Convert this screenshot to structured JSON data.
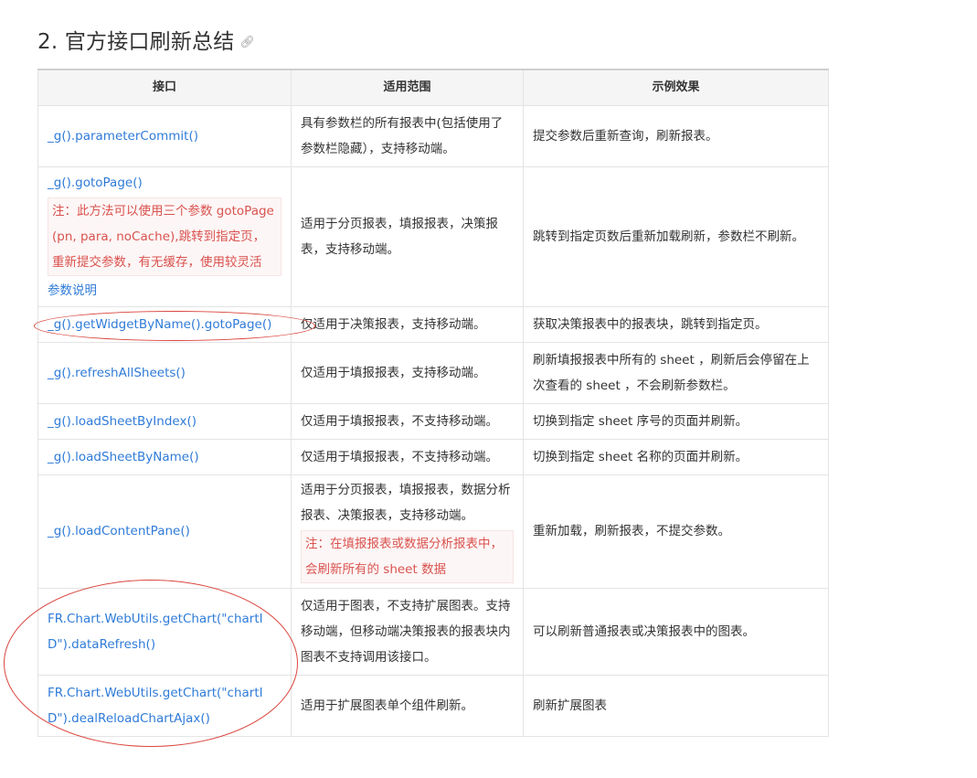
{
  "heading": {
    "title": "2. 官方接口刷新总结"
  },
  "table": {
    "headers": [
      "接口",
      "适用范围",
      "示例效果"
    ],
    "rows": [
      {
        "api": "_g().parameterCommit()",
        "scope": "具有参数栏的所有报表中(包括使用了参数栏隐藏），支持移动端。",
        "effect": "提交参数后重新查询，刷新报表。"
      },
      {
        "api": "_g().gotoPage()",
        "api_note": "注：此方法可以使用三个参数 gotoPage(pn, para, noCache),跳转到指定页，重新提交参数，有无缓存，使用较灵活",
        "api_link": "参数说明",
        "scope": "适用于分页报表，填报报表，决策报表，支持移动端。",
        "effect": "跳转到指定页数后重新加载刷新，参数栏不刷新。"
      },
      {
        "api": "_g().getWidgetByName().gotoPage()",
        "scope": "仅适用于决策报表，支持移动端。",
        "effect": "获取决策报表中的报表块，跳转到指定页。"
      },
      {
        "api": "_g().refreshAllSheets()",
        "scope": "仅适用于填报报表，支持移动端。",
        "effect": "刷新填报报表中所有的 sheet ，刷新后会停留在上次查看的 sheet ，不会刷新参数栏。"
      },
      {
        "api": "_g().loadSheetByIndex()",
        "scope": "仅适用于填报报表，不支持移动端。",
        "effect": "切换到指定 sheet 序号的页面并刷新。"
      },
      {
        "api": "_g().loadSheetByName()",
        "scope": "仅适用于填报报表，不支持移动端。",
        "effect": "切换到指定 sheet 名称的页面并刷新。"
      },
      {
        "api": "_g().loadContentPane()",
        "scope": "适用于分页报表，填报报表，数据分析报表、决策报表，支持移动端。",
        "scope_note": "注：在填报报表或数据分析报表中，会刷新所有的 sheet 数据",
        "effect": "重新加载，刷新报表，不提交参数。"
      },
      {
        "api": "FR.Chart.WebUtils.getChart(\"chartID\").dataRefresh()",
        "scope": "仅适用于图表，不支持扩展图表。支持移动端，但移动端决策报表的报表块内图表不支持调用该接口。",
        "effect": "可以刷新普通报表或决策报表中的图表。"
      },
      {
        "api": "FR.Chart.WebUtils.getChart(\"chartID\").dealReloadChartAjax()",
        "scope": "适用于扩展图表单个组件刷新。",
        "effect": "刷新扩展图表"
      }
    ]
  }
}
